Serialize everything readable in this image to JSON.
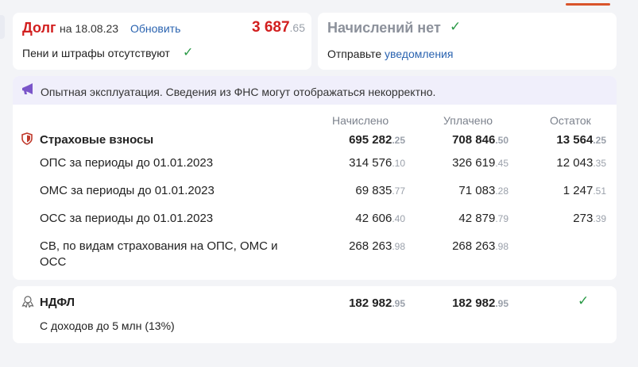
{
  "debt": {
    "title": "Долг",
    "on": "на",
    "date": "18.08.23",
    "refresh": "Обновить",
    "amount_int": "3 687",
    "amount_frac": ".65",
    "penalty": "Пени и штрафы отсутствуют"
  },
  "accruals": {
    "title": "Начислений нет",
    "notify_prefix": "Отправьте",
    "notify_link": "уведомления"
  },
  "banner": {
    "text": "Опытная эксплуатация. Сведения из ФНС могут отображаться некорректно."
  },
  "columns": {
    "accrued": "Начислено",
    "paid": "Уплачено",
    "balance": "Остаток"
  },
  "insurance": {
    "title": "Страховые взносы",
    "accrued_int": "695 282",
    "accrued_frac": ".25",
    "paid_int": "708 846",
    "paid_frac": ".50",
    "balance_int": "13 564",
    "balance_frac": ".25",
    "rows": [
      {
        "label": "ОПС за периоды до 01.01.2023",
        "accrued_int": "314 576",
        "accrued_frac": ".10",
        "paid_int": "326 619",
        "paid_frac": ".45",
        "balance_int": "12 043",
        "balance_frac": ".35"
      },
      {
        "label": "ОМС за периоды до 01.01.2023",
        "accrued_int": "69 835",
        "accrued_frac": ".77",
        "paid_int": "71 083",
        "paid_frac": ".28",
        "balance_int": "1 247",
        "balance_frac": ".51"
      },
      {
        "label": "ОСС за периоды до 01.01.2023",
        "accrued_int": "42 606",
        "accrued_frac": ".40",
        "paid_int": "42 879",
        "paid_frac": ".79",
        "balance_int": "273",
        "balance_frac": ".39"
      },
      {
        "label_line1": "СВ, по видам страхования на ОПС, ОМС и",
        "label_line2": "ОСС",
        "accrued_int": "268 263",
        "accrued_frac": ".98",
        "paid_int": "268 263",
        "paid_frac": ".98"
      }
    ]
  },
  "ndfl": {
    "title": "НДФЛ",
    "subtitle": "С доходов до 5 млн (13%)",
    "accrued_int": "182 982",
    "accrued_frac": ".95",
    "paid_int": "182 982",
    "paid_frac": ".95"
  },
  "icons": {
    "check": "check-icon",
    "megaphone": "megaphone-icon",
    "shield": "shield-icon",
    "ndfl": "person-ribbon-icon"
  },
  "colors": {
    "debt": "#d21f1f",
    "link": "#2a63b0",
    "check": "#2b9a47",
    "banner": "#f0effb",
    "accent": "#d9542b"
  }
}
